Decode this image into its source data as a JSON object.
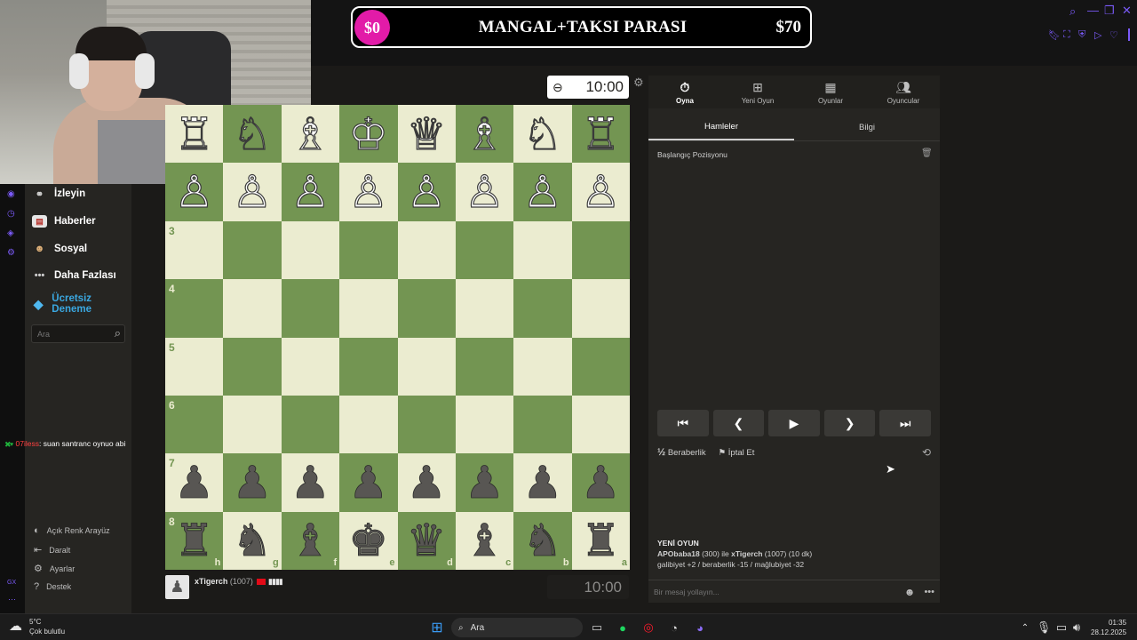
{
  "donation_goal": {
    "current": "$0",
    "title": "MANGAL+TAKSI PARASI",
    "target": "$70"
  },
  "sidebar": {
    "items": [
      {
        "label": "İzleyin"
      },
      {
        "label": "Haberler"
      },
      {
        "label": "Sosyal"
      },
      {
        "label": "Daha Fazlası"
      },
      {
        "label": "Ücretsiz Deneme"
      }
    ],
    "search_placeholder": "Ara",
    "footer": [
      {
        "label": "Açık Renk Arayüz"
      },
      {
        "label": "Daralt"
      },
      {
        "label": "Ayarlar"
      },
      {
        "label": "Destek"
      }
    ]
  },
  "stream_chat": {
    "user": "07iless",
    "message": ": suan santranc oynuo abi"
  },
  "board": {
    "rank_labels": [
      "3",
      "4",
      "5",
      "6",
      "7",
      "8"
    ],
    "file_labels": [
      "h",
      "g",
      "f",
      "e",
      "d",
      "c",
      "b",
      "a"
    ],
    "pieces": {
      "rank1": [
        "♖",
        "♘",
        "♗",
        "♔",
        "♕",
        "♗",
        "♘",
        "♖"
      ],
      "rank2": [
        "♙",
        "♙",
        "♙",
        "♙",
        "♙",
        "♙",
        "♙",
        "♙"
      ],
      "rank7": [
        "♟",
        "♟",
        "♟",
        "♟",
        "♟",
        "♟",
        "♟",
        "♟"
      ],
      "rank8": [
        "♜",
        "♞",
        "♝",
        "♚",
        "♛",
        "♝",
        "♞",
        "♜"
      ]
    },
    "top_clock": "10:00",
    "bottom_clock": "10:00",
    "player_name": "xTigerch",
    "player_rating": "(1007)"
  },
  "panel": {
    "tabs": [
      {
        "label": "Oyna",
        "icon": "stopwatch-icon"
      },
      {
        "label": "Yeni Oyun",
        "icon": "plus-icon"
      },
      {
        "label": "Oyunlar",
        "icon": "board-icon"
      },
      {
        "label": "Oyuncular",
        "icon": "players-icon"
      }
    ],
    "subtabs": [
      "Hamleler",
      "Bilgi"
    ],
    "start_position": "Başlangıç Pozisyonu",
    "draw_label": "Beraberlik",
    "abort_label": "İptal Et",
    "info_title": "YENİ OYUN",
    "info_line1_bold": "APObaba18",
    "info_line1_rest": " (300) ile ",
    "info_line1_bold2": "xTigerch",
    "info_line1_end": " (1007) (10 dk)",
    "info_line2": "galibiyet +2 / beraberlik -15 / mağlubiyet -32",
    "chat_placeholder": "Bir mesaj yollayın..."
  },
  "taskbar": {
    "weather_temp": "5°C",
    "weather_desc": "Çok bulutlu",
    "search": "Ara",
    "time": "01:35",
    "date": "28.12.2025"
  }
}
